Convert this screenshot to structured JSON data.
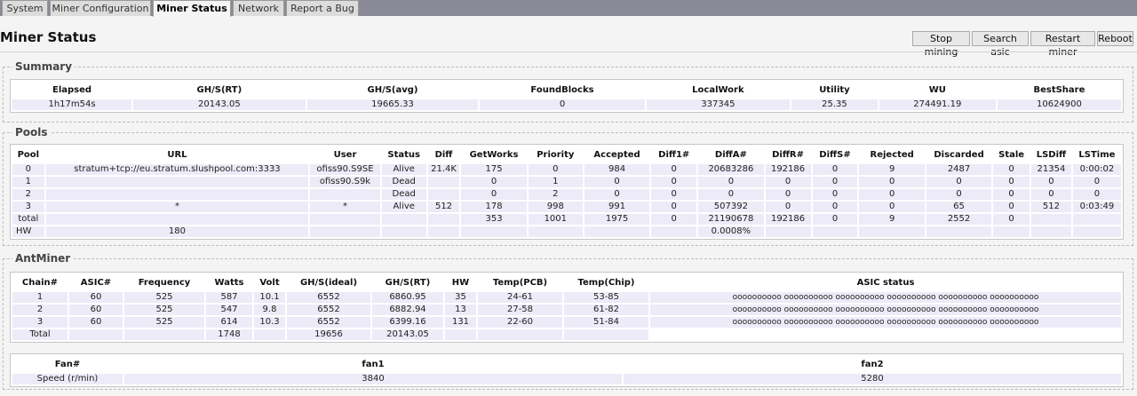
{
  "tabs": [
    "System",
    "Miner Configuration",
    "Miner Status",
    "Network",
    "Report a Bug"
  ],
  "page_title": "Miner Status",
  "buttons": {
    "stop": "Stop mining",
    "search": "Search asic",
    "restart": "Restart miner",
    "reboot": "Reboot"
  },
  "summary": {
    "legend": "Summary",
    "headers": [
      "Elapsed",
      "GH/S(RT)",
      "GH/S(avg)",
      "FoundBlocks",
      "LocalWork",
      "Utility",
      "WU",
      "BestShare"
    ],
    "row": [
      "1h17m54s",
      "20143.05",
      "19665.33",
      "0",
      "337345",
      "25.35",
      "274491.19",
      "10624900"
    ]
  },
  "pools": {
    "legend": "Pools",
    "headers": [
      "Pool",
      "URL",
      "User",
      "Status",
      "Diff",
      "GetWorks",
      "Priority",
      "Accepted",
      "Diff1#",
      "DiffA#",
      "DiffR#",
      "DiffS#",
      "Rejected",
      "Discarded",
      "Stale",
      "LSDiff",
      "LSTime"
    ],
    "rows": [
      [
        "0",
        "stratum+tcp://eu.stratum.slushpool.com:3333",
        "ofiss90.S9SE",
        "Alive",
        "21.4K",
        "175",
        "0",
        "984",
        "0",
        "20683286",
        "192186",
        "0",
        "9",
        "2487",
        "0",
        "21354",
        "0:00:02"
      ],
      [
        "1",
        "",
        "ofiss90.S9k",
        "Dead",
        "",
        "0",
        "1",
        "0",
        "0",
        "0",
        "0",
        "0",
        "0",
        "0",
        "0",
        "0",
        "0"
      ],
      [
        "2",
        "",
        "",
        "Dead",
        "",
        "0",
        "2",
        "0",
        "0",
        "0",
        "0",
        "0",
        "0",
        "0",
        "0",
        "0",
        "0"
      ],
      [
        "3",
        "*",
        "*",
        "Alive",
        "512",
        "178",
        "998",
        "991",
        "0",
        "507392",
        "0",
        "0",
        "0",
        "65",
        "0",
        "512",
        "0:03:49"
      ],
      [
        "total",
        "",
        "",
        "",
        "",
        "353",
        "1001",
        "1975",
        "0",
        "21190678",
        "192186",
        "0",
        "9",
        "2552",
        "0",
        "",
        ""
      ]
    ],
    "hw_label": "HW",
    "hw_value": "180",
    "hw_percent": "0.0008%"
  },
  "antminer": {
    "legend": "AntMiner",
    "headers": [
      "Chain#",
      "ASIC#",
      "Frequency",
      "Watts",
      "Volt",
      "GH/S(ideal)",
      "GH/S(RT)",
      "HW",
      "Temp(PCB)",
      "Temp(Chip)",
      "ASIC status"
    ],
    "rows": [
      [
        "1",
        "60",
        "525",
        "587",
        "10.1",
        "6552",
        "6860.95",
        "35",
        "24-61",
        "53-85",
        "oooooooooo oooooooooo oooooooooo oooooooooo oooooooooo oooooooooo"
      ],
      [
        "2",
        "60",
        "525",
        "547",
        "9.8",
        "6552",
        "6882.94",
        "13",
        "27-58",
        "61-82",
        "oooooooooo oooooooooo oooooooooo oooooooooo oooooooooo oooooooooo"
      ],
      [
        "3",
        "60",
        "525",
        "614",
        "10.3",
        "6552",
        "6399.16",
        "131",
        "22-60",
        "51-84",
        "oooooooooo oooooooooo oooooooooo oooooooooo oooooooooo oooooooooo"
      ]
    ],
    "total": {
      "label": "Total",
      "watts": "1748",
      "ideal": "19656",
      "rt": "20143.05"
    }
  },
  "fans": {
    "headers": [
      "Fan#",
      "fan1",
      "fan2"
    ],
    "row_label": "Speed (r/min)",
    "values": [
      "3840",
      "5280"
    ]
  }
}
